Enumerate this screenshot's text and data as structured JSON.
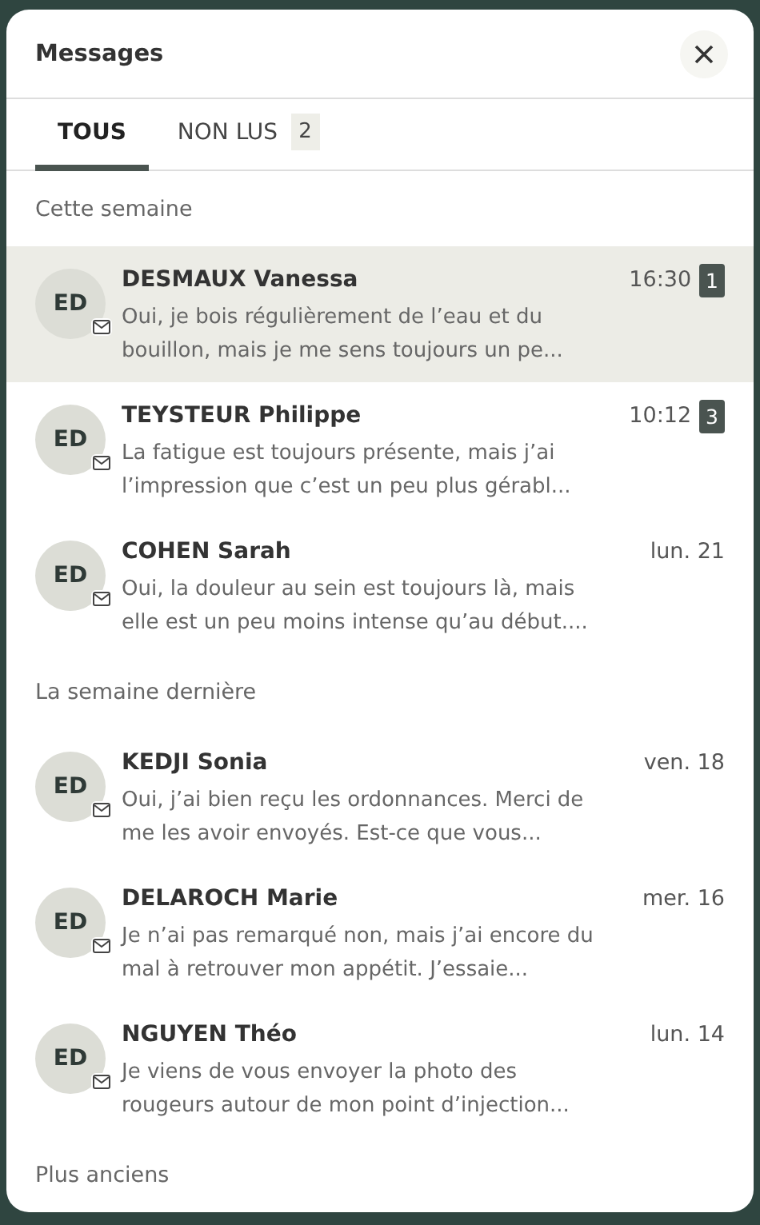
{
  "window": {
    "title": "Messages"
  },
  "tabs": [
    {
      "label": "TOUS",
      "selected": true
    },
    {
      "label": "NON LUS",
      "count": "2",
      "selected": false
    }
  ],
  "groups": [
    {
      "label": "Cette semaine",
      "messages": [
        {
          "initials": "ED",
          "name": "DESMAUX Vanessa",
          "time": "16:30",
          "unread": "1",
          "preview": "Oui, je bois régulièrement de l’eau et du bouillon, mais je me sens toujours un pe...",
          "selected": true
        },
        {
          "initials": "ED",
          "name": "TEYSTEUR Philippe",
          "time": "10:12",
          "unread": "3",
          "preview": "La fatigue est toujours présente, mais j’ai l’impression que c’est un peu plus gérabl...",
          "selected": false
        },
        {
          "initials": "ED",
          "name": "COHEN Sarah",
          "time": "lun. 21",
          "preview": "Oui, la douleur au sein est toujours là, mais elle est un peu moins intense qu’au début....",
          "selected": false
        }
      ]
    },
    {
      "label": "La semaine dernière",
      "messages": [
        {
          "initials": "ED",
          "name": "KEDJI Sonia",
          "time": "ven. 18",
          "preview": "Oui, j’ai bien reçu les ordonnances. Merci de me les avoir envoyés. Est-ce que vous...",
          "selected": false
        },
        {
          "initials": "ED",
          "name": "DELAROCH Marie",
          "time": "mer. 16",
          "preview": "Je n’ai pas remarqué non, mais j’ai encore du mal à retrouver mon appétit. J’essaie...",
          "selected": false
        },
        {
          "initials": "ED",
          "name": "NGUYEN Théo",
          "time": "lun. 14",
          "preview": "Je viens de vous envoyer la photo des rougeurs autour de mon point d’injection...",
          "selected": false
        }
      ]
    },
    {
      "label": "Plus anciens"
    }
  ]
}
